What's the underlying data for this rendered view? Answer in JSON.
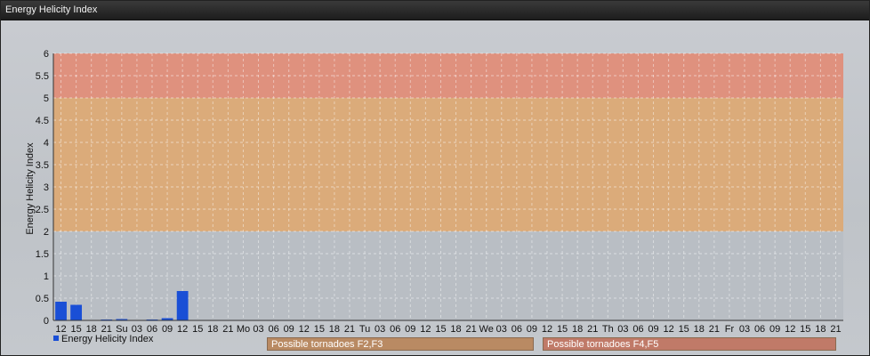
{
  "window": {
    "title": "Energy Helicity Index"
  },
  "legend": {
    "series_label": "Energy Helicity Index"
  },
  "zones": [
    {
      "label": "Possible tornadoes F2,F3",
      "color": "#b98a63"
    },
    {
      "label": "Possible tornadoes F4,F5",
      "color": "#c07a68"
    }
  ],
  "colors": {
    "bar": "#1a4fd6",
    "zone_f2f3": "#e0a86d",
    "zone_f4f5": "#e58a72",
    "grid": "#ffffff"
  },
  "chart_data": {
    "type": "bar",
    "title": "Energy Helicity Index",
    "ylabel": "Energy Helicity Index",
    "xlabel": "",
    "ylim": [
      0,
      6
    ],
    "yticks": [
      "0",
      "0.5",
      "1",
      "1.5",
      "2",
      "2.5",
      "3",
      "3.5",
      "4",
      "4.5",
      "5",
      "5.5",
      "6"
    ],
    "bands": [
      {
        "from": 2,
        "to": 5,
        "label": "Possible tornadoes F2,F3"
      },
      {
        "from": 5,
        "to": 6,
        "label": "Possible tornadoes F4,F5"
      }
    ],
    "categories": [
      "12",
      "15",
      "18",
      "21",
      "Su",
      "03",
      "06",
      "09",
      "12",
      "15",
      "18",
      "21",
      "Mo",
      "03",
      "06",
      "09",
      "12",
      "15",
      "18",
      "21",
      "Tu",
      "03",
      "06",
      "09",
      "12",
      "15",
      "18",
      "21",
      "We",
      "03",
      "06",
      "09",
      "12",
      "15",
      "18",
      "21",
      "Th",
      "03",
      "06",
      "09",
      "12",
      "15",
      "18",
      "21",
      "Fr",
      "03",
      "06",
      "09",
      "12",
      "15",
      "18",
      "21"
    ],
    "series": [
      {
        "name": "Energy Helicity Index",
        "values": [
          0.42,
          0.35,
          0.01,
          0.02,
          0.03,
          0.01,
          0.02,
          0.05,
          0.66,
          0.01,
          0.01,
          0.01,
          0.01,
          0.01,
          0.01,
          0.01,
          0.01,
          0.01,
          0.01,
          0.01,
          0.01,
          0.01,
          0.01,
          0.01,
          0.01,
          0.01,
          0.01,
          0.01,
          0.01,
          0.01,
          0.01,
          0.01,
          0.01,
          0.01,
          0.01,
          0.01,
          0.01,
          0.01,
          0.01,
          0.01,
          0.01,
          0.01,
          0.01,
          0.01,
          0.01,
          0.01,
          0.01,
          0.01,
          0.01,
          0.01,
          0.01,
          0.01
        ]
      }
    ],
    "legend_position": "bottom-left",
    "grid": true
  }
}
